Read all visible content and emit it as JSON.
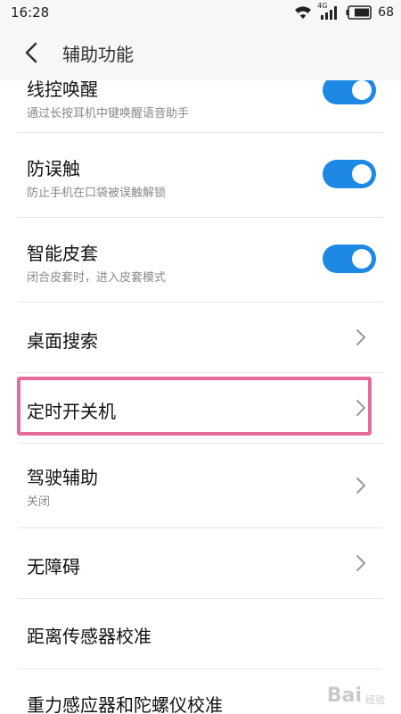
{
  "status_bar": {
    "time": "16:28",
    "network_label": "4G",
    "battery": "68",
    "icons": [
      "wifi-icon",
      "signal-icon",
      "battery-icon"
    ]
  },
  "header": {
    "title": "辅助功能",
    "back_icon": "chevron-left-icon"
  },
  "settings": [
    {
      "title": "线控唤醒",
      "subtitle": "通过长按耳机中键唤醒语音助手",
      "control": "toggle",
      "on": true
    },
    {
      "title": "防误触",
      "subtitle": "防止手机在口袋被误触解锁",
      "control": "toggle",
      "on": true
    },
    {
      "title": "智能皮套",
      "subtitle": "闭合皮套时，进入皮套模式",
      "control": "toggle",
      "on": true
    },
    {
      "title": "桌面搜索",
      "subtitle": "",
      "control": "chevron"
    },
    {
      "title": "定时开关机",
      "subtitle": "",
      "control": "chevron",
      "highlighted": true
    },
    {
      "title": "驾驶辅助",
      "subtitle": "关闭",
      "control": "chevron"
    },
    {
      "title": "无障碍",
      "subtitle": "",
      "control": "chevron"
    },
    {
      "title": "距离传感器校准",
      "subtitle": "",
      "control": "none"
    },
    {
      "title": "重力感应器和陀螺仪校准",
      "subtitle": "",
      "control": "none"
    }
  ],
  "colors": {
    "accent": "#1e88e5",
    "highlight": "#e66a9a",
    "background": "#ffffff",
    "header_bg": "#f7f7f7"
  },
  "watermark": {
    "logo": "Bai",
    "text": "经验"
  }
}
